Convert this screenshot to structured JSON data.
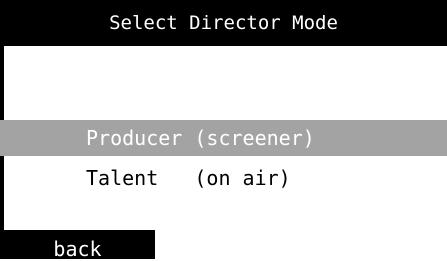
{
  "header": {
    "title": "Select Director Mode"
  },
  "menu": {
    "items": [
      {
        "label": "Producer (screener)",
        "selected": true
      },
      {
        "label": "Talent   (on air)",
        "selected": false
      }
    ]
  },
  "footer": {
    "back_label": "back"
  },
  "colors": {
    "background": "#ffffff",
    "title_bar": "#000000",
    "selection": "#a3a3a3",
    "text": "#000000",
    "inverse_text": "#ffffff"
  }
}
